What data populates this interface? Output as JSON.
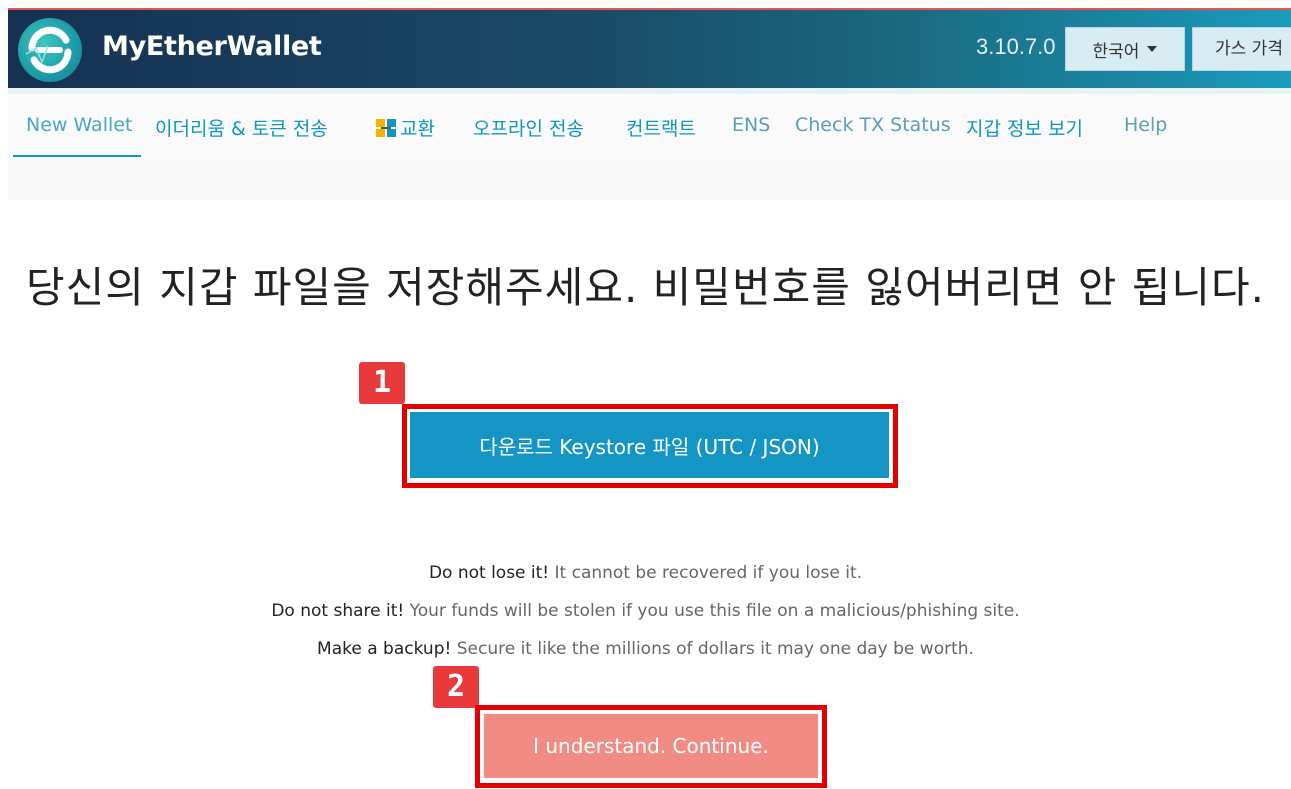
{
  "header": {
    "brand": "MyEtherWallet",
    "version": "3.10.7.0",
    "language": "한국어",
    "gas_price": "가스 가격"
  },
  "nav": {
    "items": [
      {
        "label": "New Wallet"
      },
      {
        "label": "이더리움 & 토큰 전송"
      },
      {
        "label": "교환",
        "icon": "swap-icon"
      },
      {
        "label": "오프라인 전송"
      },
      {
        "label": "컨트랙트"
      },
      {
        "label": "ENS"
      },
      {
        "label": "Check TX Status"
      },
      {
        "label": "지갑 정보 보기"
      },
      {
        "label": "Help"
      }
    ]
  },
  "main": {
    "headline": "당신의 지갑 파일을 저장해주세요. 비밀번호를 잃어버리면 안 됩니다.",
    "download_button": "다운로드 Keystore 파일 (UTC / JSON)",
    "warnings": [
      {
        "bold": "Do not lose it!",
        "text": " It cannot be recovered if you lose it."
      },
      {
        "bold": "Do not share it!",
        "text": " Your funds will be stolen if you use this file on a malicious/phishing site."
      },
      {
        "bold": "Make a backup!",
        "text": " Secure it like the millions of dollars it may one day be worth."
      }
    ],
    "continue_button": "I understand. Continue."
  },
  "annotations": {
    "marker_1": "1",
    "marker_2": "2"
  },
  "colors": {
    "header_dark": "#163151",
    "accent_blue": "#1595c4",
    "continue_pink": "#f08c84",
    "highlight_red": "#e50000"
  }
}
